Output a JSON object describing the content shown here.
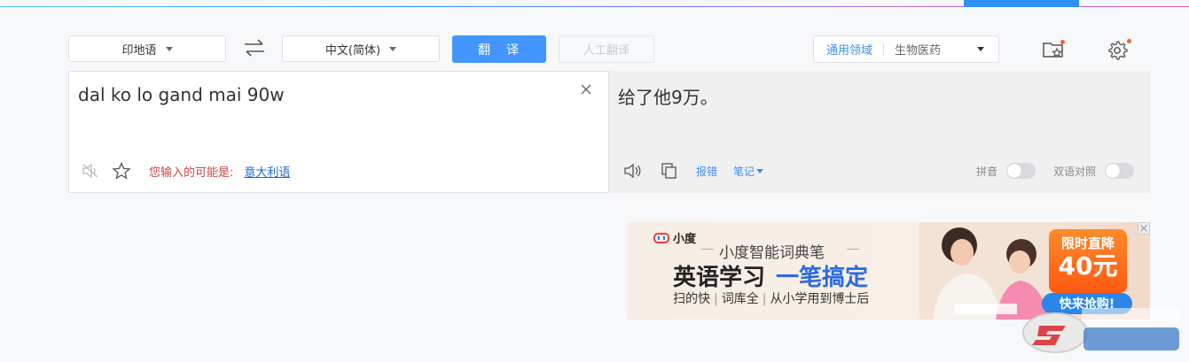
{
  "toolbar": {
    "source_lang": "印地语",
    "target_lang": "中文(简体)",
    "translate_label": "翻译",
    "human_translate_label": "人工翻译",
    "domain_primary": "通用领域",
    "domain_secondary": "生物医药"
  },
  "source": {
    "text": "dal ko lo gand mai 90w",
    "hint_label": "您输入的可能是:",
    "hint_language": "意大利语"
  },
  "result": {
    "text": "给了他9万。",
    "report_label": "报错",
    "notes_label": "笔记",
    "pinyin_label": "拼音",
    "bilingual_label": "双语对照"
  },
  "ad": {
    "brand": "小度",
    "subtitle": "小度智能词典笔",
    "headline_a": "英语学习",
    "headline_b": "一笔搞定",
    "feature_1": "扫的快",
    "feature_2": "词库全",
    "feature_3": "从小学用到博士后",
    "badge_line1": "限时直降",
    "badge_price": "40元",
    "cta": "快来抢购!"
  },
  "colors": {
    "accent": "#4395ff",
    "link": "#1a6ccf",
    "hint": "#cc4444"
  }
}
